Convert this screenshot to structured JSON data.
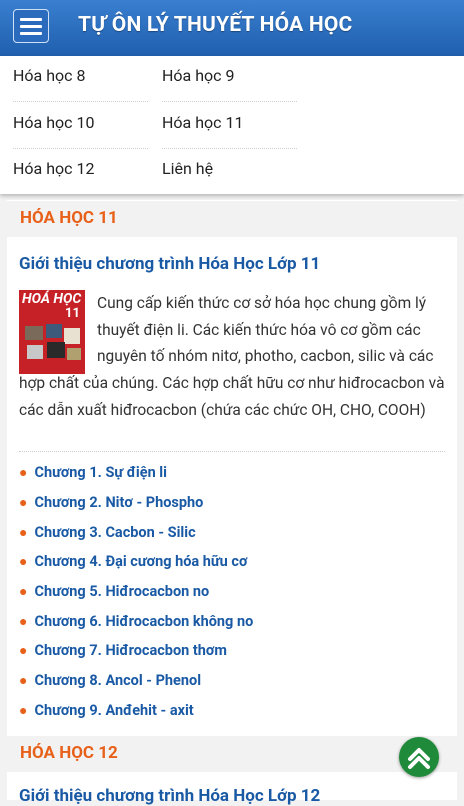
{
  "header": {
    "title": "TỰ ÔN LÝ THUYẾT HÓA HỌC"
  },
  "menu": {
    "items": [
      "Hóa học 8",
      "Hóa học 9",
      "Hóa học 10",
      "Hóa học 11",
      "Hóa học 12",
      "Liên hệ"
    ]
  },
  "section1": {
    "heading": "HÓA HỌC 11",
    "intro_title": "Giới thiệu chương trình Hóa Học Lớp 11",
    "book": {
      "title": "HOÁ HỌC",
      "number": "11"
    },
    "description": "Cung cấp kiến thức cơ sở hóa học chung gồm lý thuyết điện li. Các kiến thức hóa vô cơ gồm các nguyên tố nhóm nitơ, photho, cacbon, silic và các hợp chất của chúng. Các hợp chất hữu cơ như hiđrocacbon và các dẫn xuất hiđrocacbon (chứa các chức OH, CHO, COOH)",
    "chapters": [
      "Chương 1. Sự điện li",
      "Chương 2. Nitơ - Phospho",
      "Chương 3. Cacbon - Silic",
      "Chương 4. Đại cương hóa hữu cơ",
      "Chương 5. Hiđrocacbon no",
      "Chương 6. Hiđrocacbon không no",
      "Chương 7. Hiđrocacbon thơm",
      "Chương 8. Ancol - Phenol",
      "Chương 9. Anđehit - axit"
    ]
  },
  "section2": {
    "heading": "HÓA HỌC 12",
    "intro_title": "Giới thiệu chương trình Hóa Học Lớp 12"
  },
  "icons": {
    "menu": "hamburger-icon",
    "back_to_top": "chevron-up-icon"
  },
  "colors": {
    "header": "#2b6bbd",
    "section_heading": "#e8611a",
    "link": "#1a5aa5",
    "fab": "#1e8a3a"
  }
}
